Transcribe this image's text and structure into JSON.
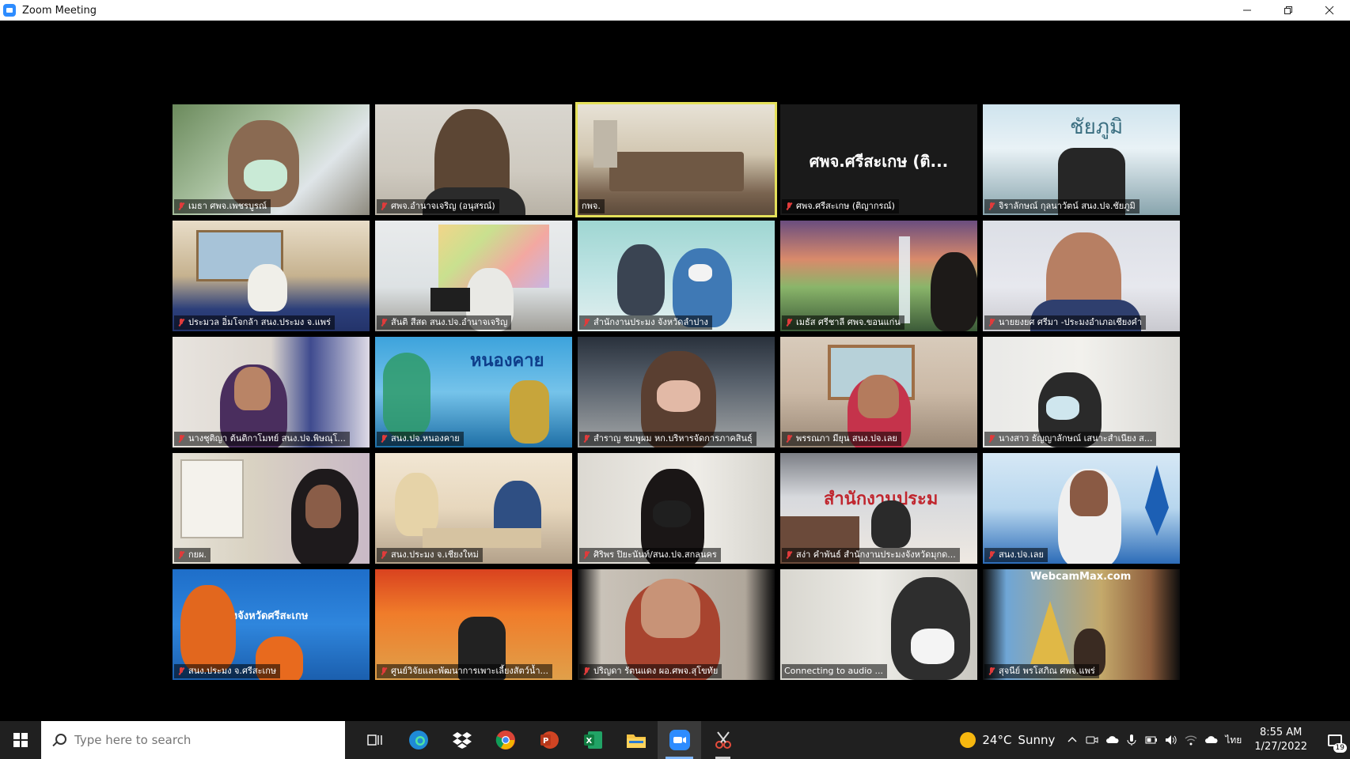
{
  "window": {
    "title": "Zoom Meeting"
  },
  "active_speaker_index": 2,
  "participants": [
    {
      "name": "เมธา ศพจ.เพชรบูรณ์",
      "muted": true
    },
    {
      "name": "ศพจ.อำนาจเจริญ (อนุสรณ์)",
      "muted": true
    },
    {
      "name": "กพจ.",
      "muted": false
    },
    {
      "name": "ศพจ.ศรีสะเกษ (ติญากรณ์)",
      "muted": true,
      "display_text": "ศพจ.ศรีสะเกษ (ติ..."
    },
    {
      "name": "จิราลักษณ์ กุลนาวัตน์ สนง.ปจ.ชัยภูมิ",
      "muted": true
    },
    {
      "name": "ประมวล อิ่มโจกล้า สนง.ประมง จ.แพร่",
      "muted": true
    },
    {
      "name": "สันติ สีสด สนง.ปจ.อำนาจเจริญ",
      "muted": true
    },
    {
      "name": "สำนักงานประมง จังหวัดลำปาง",
      "muted": true
    },
    {
      "name": "เมธัส ศรีชาลี ศพจ.ขอนแก่น",
      "muted": true
    },
    {
      "name": "นายยงยศ ศรีมา -ประมงอำเภอเชียงคำ",
      "muted": true
    },
    {
      "name": "นางชุติญา ต้นติกาโมทย์ สนง.ปจ.พิษณุโ...",
      "muted": true
    },
    {
      "name": "สนง.ปจ.หนองคาย",
      "muted": true
    },
    {
      "name": "สำราญ ชมพูผม หก.บริหารจัดการภาคสินธุ์",
      "muted": true
    },
    {
      "name": "พรรณภา มียุน สนง.ปจ.เลย",
      "muted": true
    },
    {
      "name": "นางสาว ธัญญาลักษณ์ เสนาะสำเนียง ส...",
      "muted": true
    },
    {
      "name": "กยผ.",
      "muted": true
    },
    {
      "name": "สนง.ประมง จ.เชียงใหม่",
      "muted": true
    },
    {
      "name": "ศิริพร ปิยะนันท์/สนง.ปจ.สกลนคร",
      "muted": true
    },
    {
      "name": "สง่า คำพันธ์ สำนักงานประมงจังหวัดมุกด...",
      "muted": true
    },
    {
      "name": "สนง.ปจ.เลย",
      "muted": true
    },
    {
      "name": "สนง.ประมง จ.ศรีสะเกษ",
      "muted": true
    },
    {
      "name": "ศูนย์วิจัยและพัฒนาการเพาะเลี้ยงสัตว์น้ำ...",
      "muted": true
    },
    {
      "name": "ปริญดา รัตนแดง ผอ.ศพจ.สุโขทัย",
      "muted": true
    },
    {
      "name": "Connecting to audio ...",
      "muted": false
    },
    {
      "name": "สุจนีย์ พรโสภิณ ศพจ.แพร่",
      "muted": true
    }
  ],
  "tile_texts": {
    "nongkhai_banner": "หนองคาย",
    "chaiyaphum_banner": "ชัยภูมิ",
    "webcam_banner": "WebcamMax.com",
    "sisaket_office": "ประมงจังหวัดศรีสะเกษ",
    "mukdahan_office": "สำนักงานประม"
  },
  "taskbar": {
    "search_placeholder": "Type here to search",
    "weather_temp": "24°C",
    "weather_desc": "Sunny",
    "language": "ไทย",
    "time": "8:55 AM",
    "date": "1/27/2022",
    "notification_count": "19"
  },
  "colors": {
    "active_speaker_border": "#e4e05a",
    "zoom_blue": "#2D8CFF",
    "taskbar_bg": "#202020"
  }
}
